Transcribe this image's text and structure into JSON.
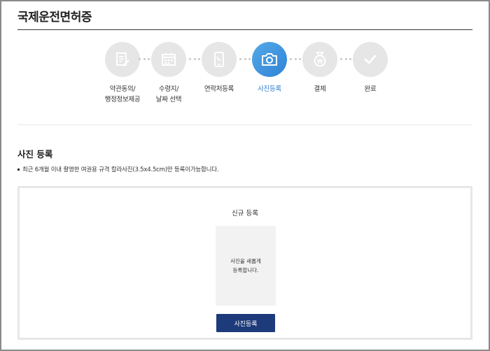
{
  "page": {
    "title": "국제운전면허증"
  },
  "steps": [
    {
      "label": "약관동의/\n행정정보제공",
      "icon": "document-pen-icon",
      "state": "inactive"
    },
    {
      "label": "수령지/\n날짜 선택",
      "icon": "calendar-icon",
      "state": "inactive"
    },
    {
      "label": "연락처등록",
      "icon": "phone-icon",
      "state": "inactive"
    },
    {
      "label": "사진등록",
      "icon": "camera-icon",
      "state": "active"
    },
    {
      "label": "결제",
      "icon": "won-bag-icon",
      "state": "inactive"
    },
    {
      "label": "완료",
      "icon": "checkmark-icon",
      "state": "inactive"
    }
  ],
  "section": {
    "title": "사진 등록",
    "notice": "최근 6개월 이내 촬영한 여권용 규격 칼라사진(3.5x4.5cm)만 등록이가능합니다."
  },
  "photo_box": {
    "title": "신규 등록",
    "placeholder": "사진을 새롭게\n등록합니다.",
    "button_label": "사진등록"
  },
  "colors": {
    "active_step": "#2f82d6",
    "inactive_step": "#e6e6e6",
    "button": "#1d3a7a"
  }
}
